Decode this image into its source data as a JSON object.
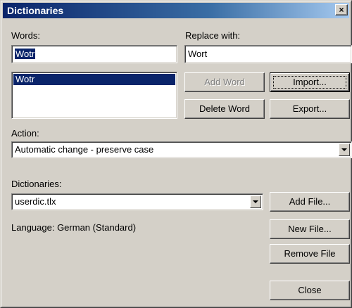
{
  "window": {
    "title": "Dictionaries",
    "close_glyph": "×"
  },
  "words": {
    "label": "Words:",
    "value": "Wotr"
  },
  "replace": {
    "label": "Replace with:",
    "value": "Wort"
  },
  "word_list": {
    "items": [
      "Wotr"
    ]
  },
  "buttons": {
    "add_word": "Add Word",
    "import": "Import...",
    "delete_word": "Delete Word",
    "export": "Export...",
    "add_file": "Add File...",
    "new_file": "New File...",
    "remove_file": "Remove File",
    "close": "Close"
  },
  "action": {
    "label": "Action:",
    "selected": "Automatic change - preserve case"
  },
  "dictionaries": {
    "label": "Dictionaries:",
    "selected": "userdic.tlx"
  },
  "language": {
    "text": "Language: German (Standard)"
  },
  "colors": {
    "face": "#d4d0c8",
    "selection": "#0a246a",
    "title_start": "#0a246a",
    "title_end": "#a6caf0"
  },
  "icons": {
    "dropdown": "chevron-down-icon",
    "close": "close-icon"
  }
}
